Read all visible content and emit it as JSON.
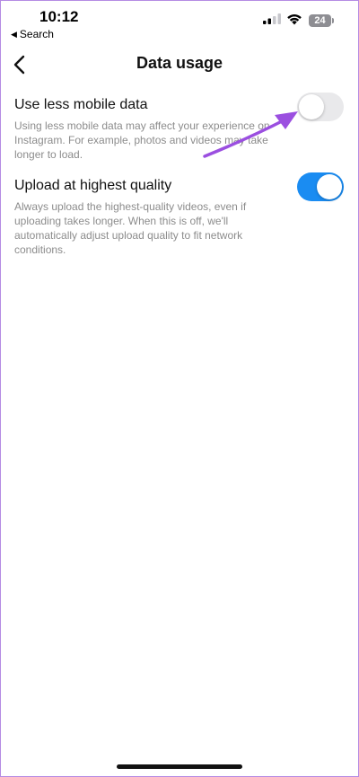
{
  "status_bar": {
    "time": "10:12",
    "back_app_label": "Search",
    "battery_level": "24"
  },
  "header": {
    "title": "Data usage"
  },
  "settings": [
    {
      "title": "Use less mobile data",
      "description": "Using less mobile data may affect your experience on Instagram. For example, photos and videos may take longer to load.",
      "enabled": false
    },
    {
      "title": "Upload at highest quality",
      "description": "Always upload the highest-quality videos, even if uploading takes longer. When this is off, we'll automatically adjust upload quality to fit network conditions.",
      "enabled": true
    }
  ],
  "colors": {
    "toggle_on": "#1a8cf2",
    "toggle_off": "#e9e9eb",
    "annotation_arrow": "#9b4fe0"
  }
}
